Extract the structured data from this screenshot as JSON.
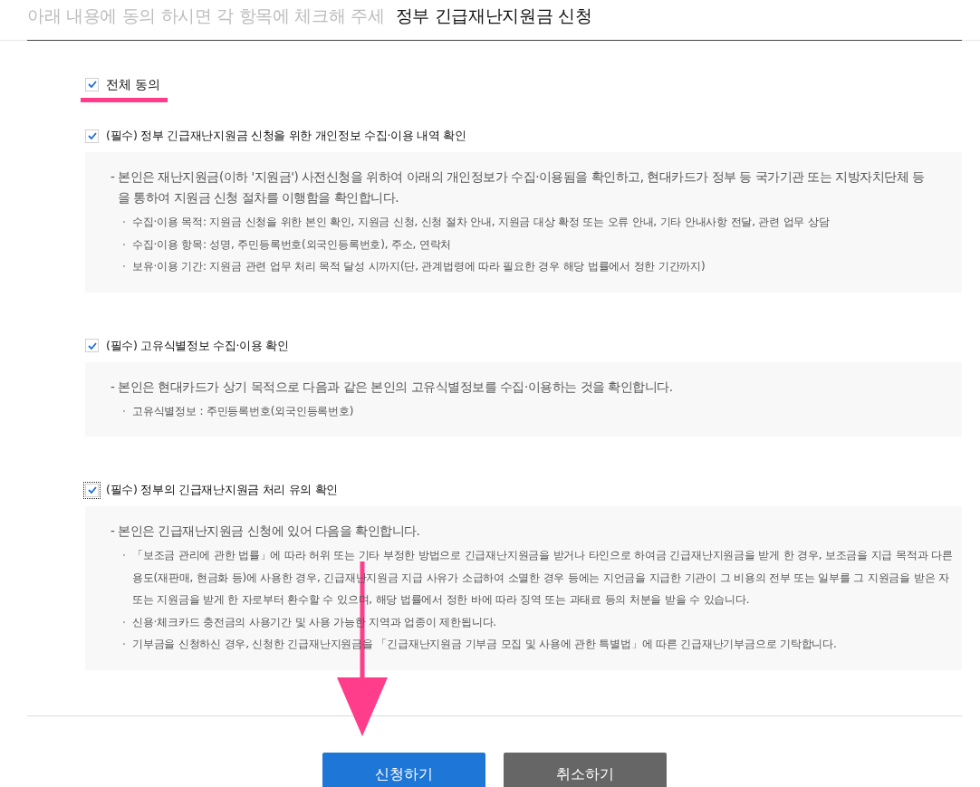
{
  "header": {
    "faded_text": "아래 내용에 동의 하시면 각 항목에 체크해 주세",
    "title": "정부 긴급재난지원금 신청"
  },
  "agree_all": {
    "label": "전체 동의",
    "checked": true,
    "focused": false
  },
  "sections": [
    {
      "label": "(필수) 정부 긴급재난지원금 신청을 위한 개인정보 수집·이용 내역 확인",
      "checked": true,
      "focused": false,
      "statement": "- 본인은 재난지원금(이하 '지원금') 사전신청을 위하여 아래의 개인정보가 수집·이용됨을 확인하고, 현대카드가 정부 등 국가기관 또는 지방자치단체 등을 통하여 지원금 신청 절차를 이행함을 확인합니다.",
      "bullets": [
        "수집·이용 목적: 지원금 신청을 위한 본인 확인, 지원금 신청, 신청 절차 안내, 지원금 대상 확정 또는 오류 안내, 기타 안내사항 전달, 관련 업무 상담",
        "수집·이용 항목: 성명, 주민등록번호(외국인등록번호), 주소, 연락처",
        "보유·이용 기간: 지원금 관련 업무 처리 목적 달성 시까지(단, 관계법령에 따라 필요한 경우 해당 법률에서 정한 기간까지)"
      ]
    },
    {
      "label": "(필수) 고유식별정보 수집·이용 확인",
      "checked": true,
      "focused": false,
      "statement": "- 본인은 현대카드가 상기 목적으로 다음과 같은 본인의 고유식별정보를 수집·이용하는 것을 확인합니다.",
      "bullets": [
        "고유식별정보 : 주민등록번호(외국인등록번호)"
      ]
    },
    {
      "label": "(필수) 정부의 긴급재난지원금 처리 유의 확인",
      "checked": true,
      "focused": true,
      "statement": "- 본인은 긴급재난지원금 신청에 있어 다음을 확인합니다.",
      "bullets": [
        "「보조금 관리에 관한 법률」에 따라 허위 또는 기타 부정한 방법으로 긴급재난지원금을 받거나 타인으로 하여금 긴급재난지원금을 받게 한 경우, 보조금을 지급 목적과 다른 용도(재판매, 현금화 등)에 사용한 경우, 긴급재난지원금 지급 사유가 소급하여 소멸한 경우 등에는 지언금을 지급한 기관이 그 비용의 전부 또는 일부를 그 지원금을 받은 자 또는 지원금을 받게 한 자로부터 환수할 수 있으며, 해당 법률에서 정한 바에 따라 징역 또는 과태료 등의 처분을 받을 수 있습니다.",
        "신용·체크카드 충전금의 사용기간 및 사용 가능한 지역과 업종이 제한됩니다.",
        "기부금을 신청하신 경우, 신청한 긴급재난지원금을 「긴급재난지원금 기부금 모집 및 사용에 관한 특별법」에 따른 긴급재난기부금으로 기탁합니다."
      ]
    }
  ],
  "buttons": [
    {
      "label": "신청하기",
      "kind": "primary"
    },
    {
      "label": "취소하기",
      "kind": "secondary"
    }
  ]
}
